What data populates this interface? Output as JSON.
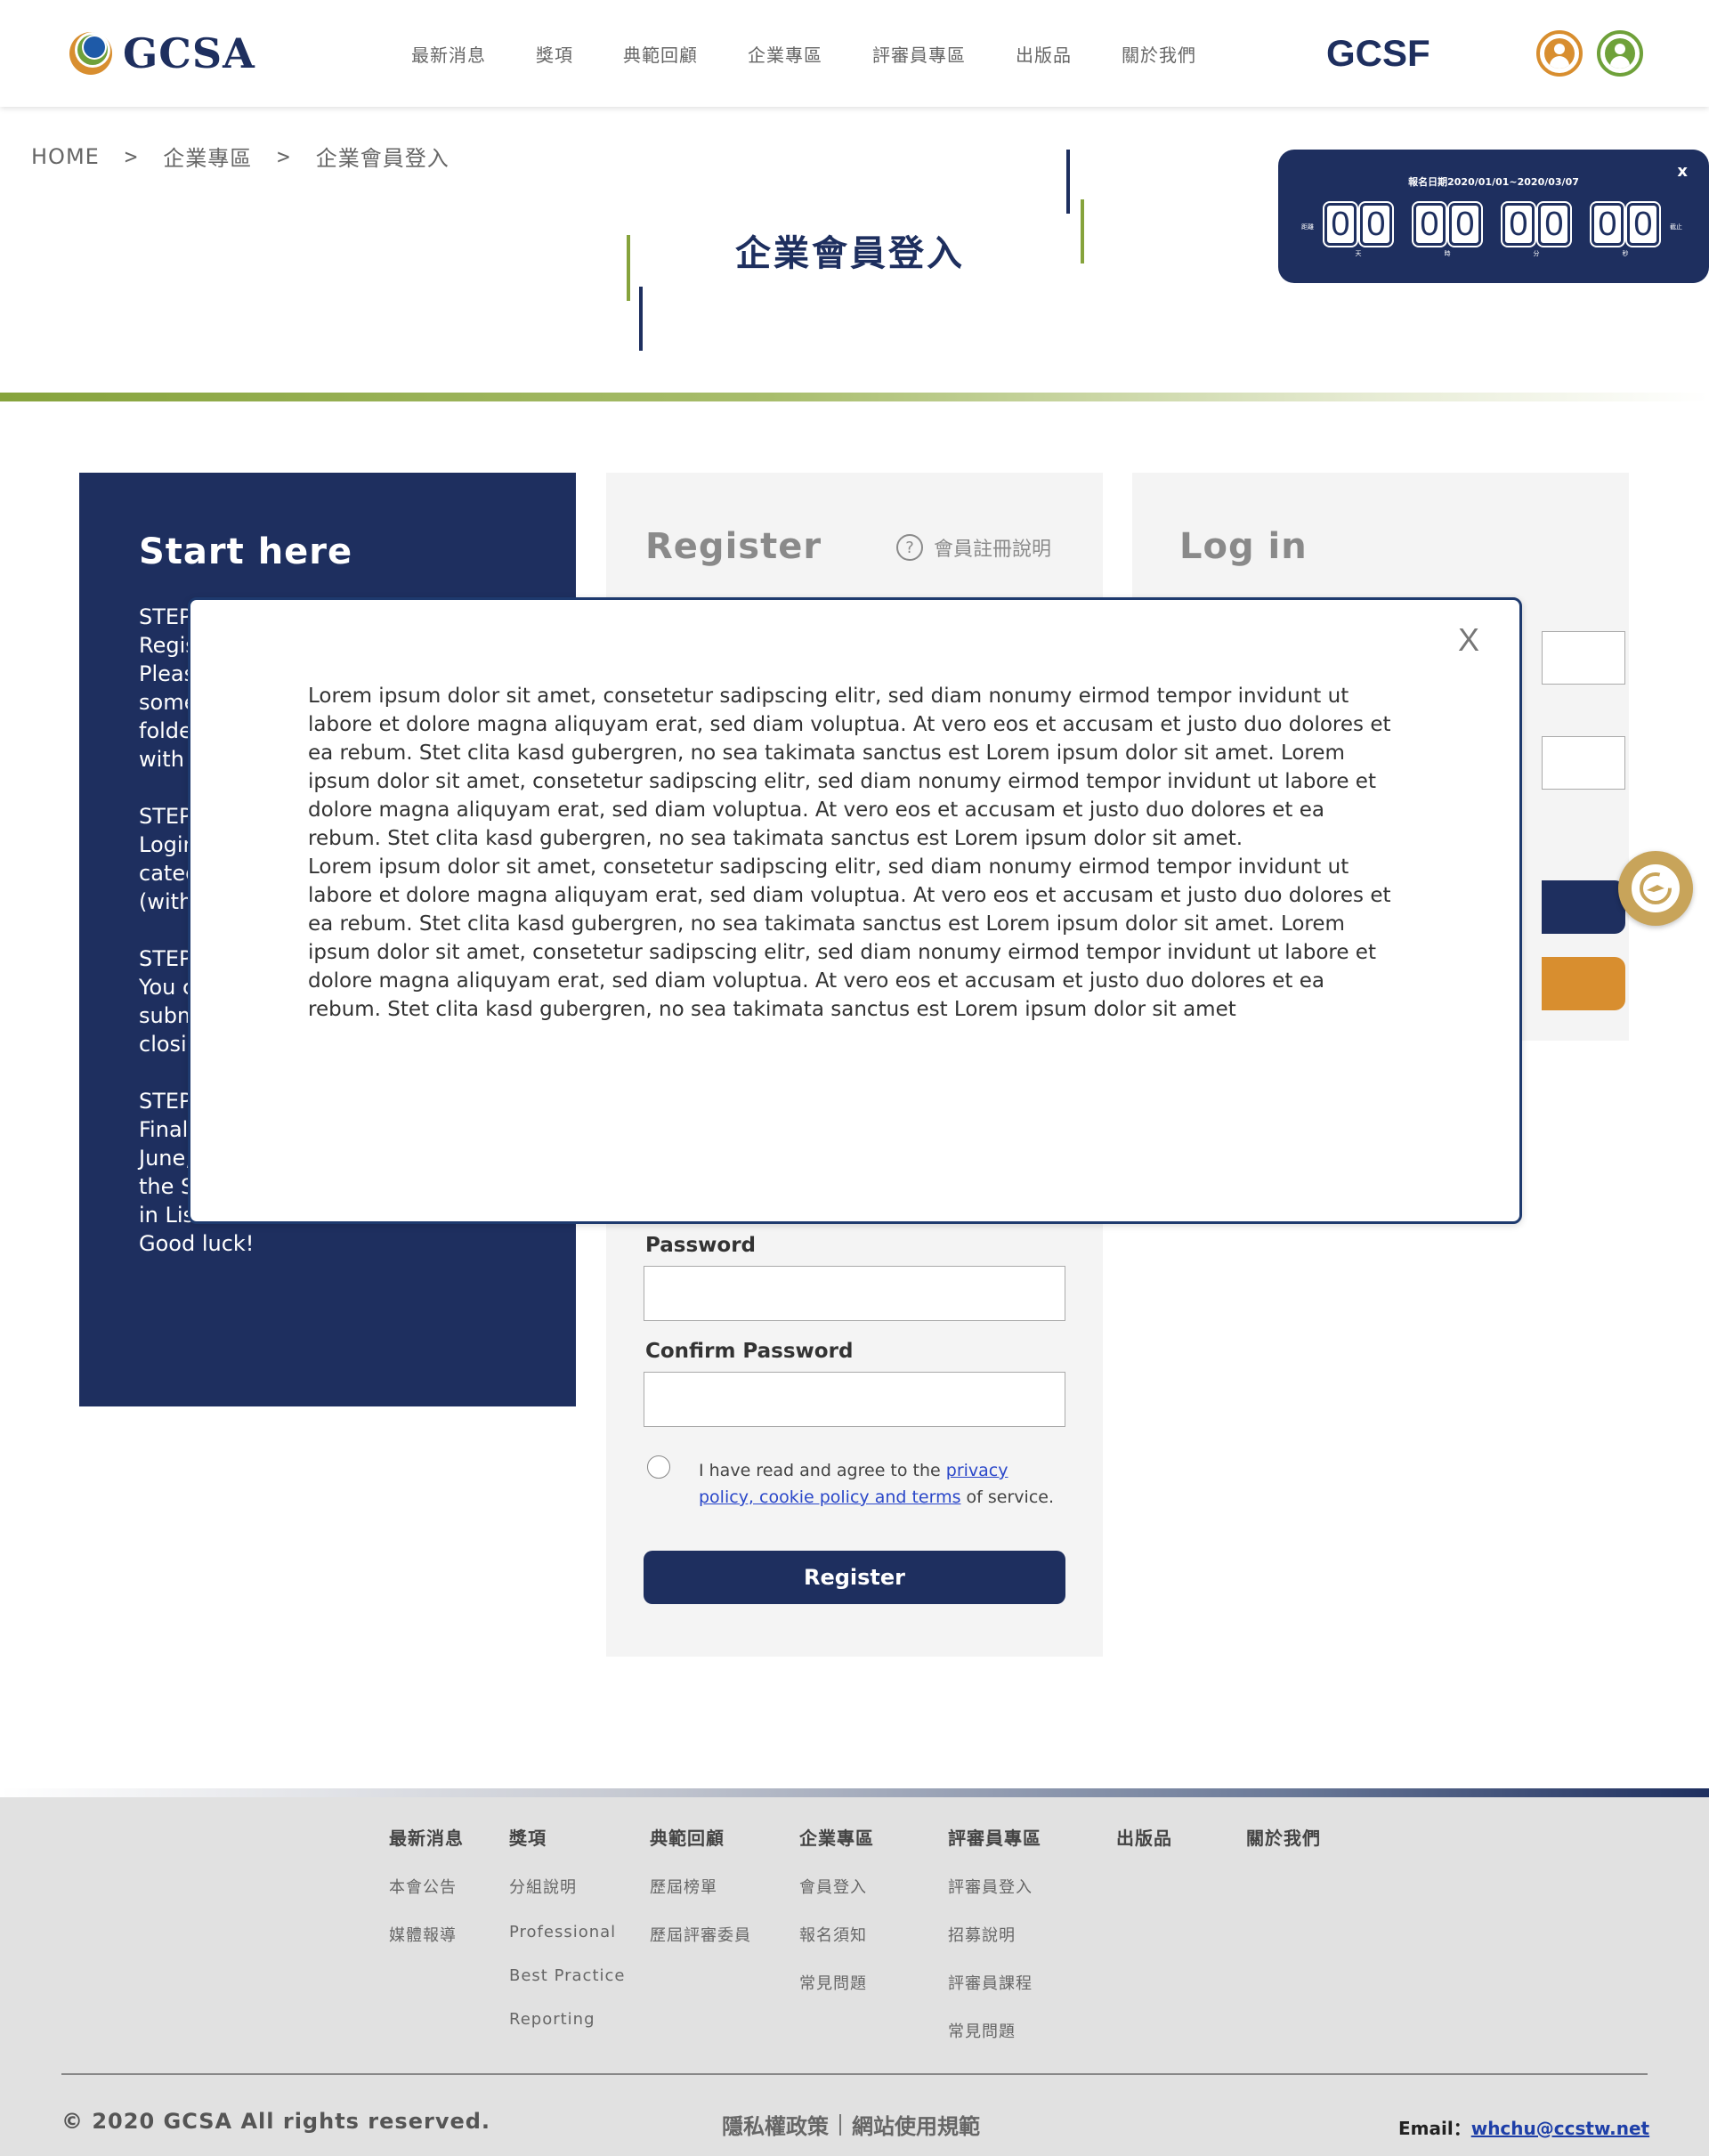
{
  "header": {
    "logo_text": "GCSA",
    "nav": [
      "最新消息",
      "獎項",
      "典範回顧",
      "企業專區",
      "評審員專區",
      "出版品",
      "關於我們"
    ],
    "brand_right": "GCSF"
  },
  "breadcrumb": [
    "HOME",
    "企業專區",
    "企業會員登入"
  ],
  "breadcrumb_sep": ">",
  "page_title": "企業會員登入",
  "countdown": {
    "close": "x",
    "date_text": "報名日期2020/01/01~2020/03/07",
    "left_label": "距離",
    "right_label": "截止",
    "units": [
      {
        "digits": [
          "0",
          "0"
        ],
        "label": "天"
      },
      {
        "digits": [
          "0",
          "0"
        ],
        "label": "時"
      },
      {
        "digits": [
          "0",
          "0"
        ],
        "label": "分"
      },
      {
        "digits": [
          "0",
          "0"
        ],
        "label": "秒"
      }
    ]
  },
  "start": {
    "title": "Start here",
    "text": "STEP\nRegis\nPleas\nsome\nfolde\nwith\n\nSTEP\nLogin\ncateg\n(with\n\nSTEP\nYou c\nsubm\nclosi\n\nSTEP\nFinal\nJune,\nthe S\nin Lis\nGood luck!"
  },
  "register": {
    "title": "Register",
    "help_label": "會員註冊說明",
    "help_icon": "?",
    "password_label": "Password",
    "confirm_label": "Confirm Password",
    "agree_prefix": "I have read and agree to the ",
    "agree_link": "privacy policy, cookie policy and terms",
    "agree_suffix": " of service.",
    "button": "Register"
  },
  "login": {
    "title": "Log in"
  },
  "modal": {
    "close": "X",
    "text": "Lorem ipsum dolor sit amet, consetetur sadipscing elitr, sed diam nonumy eirmod tempor invidunt ut labore et dolore magna aliquyam erat, sed diam voluptua. At vero eos et accusam et justo duo dolores et ea rebum. Stet clita kasd gubergren, no sea takimata sanctus est Lorem ipsum dolor sit amet. Lorem ipsum dolor sit amet, consetetur sadipscing elitr, sed diam nonumy eirmod tempor invidunt ut labore et dolore magna aliquyam erat, sed diam voluptua. At vero eos et accusam et justo duo dolores et ea rebum. Stet clita kasd gubergren, no sea takimata sanctus est Lorem ipsum dolor sit amet.",
    "text2": "Lorem ipsum dolor sit amet, consetetur sadipscing elitr, sed diam nonumy eirmod tempor invidunt ut labore et dolore magna aliquyam erat, sed diam voluptua. At vero eos et accusam et justo duo dolores et ea rebum. Stet clita kasd gubergren, no sea takimata sanctus est Lorem ipsum dolor sit amet. Lorem ipsum dolor sit amet, consetetur sadipscing elitr, sed diam nonumy eirmod tempor invidunt ut labore et dolore magna aliquyam erat, sed diam voluptua. At vero eos et accusam et justo duo dolores et ea rebum. Stet clita kasd gubergren, no sea takimata sanctus est Lorem ipsum dolor sit amet"
  },
  "footer": {
    "columns": [
      {
        "head": "最新消息",
        "items": [
          "本會公告",
          "媒體報導"
        ]
      },
      {
        "head": "獎項",
        "items": [
          "分組說明",
          "Professional",
          "Best Practice",
          "Reporting"
        ]
      },
      {
        "head": "典範回顧",
        "items": [
          "歷屆榜單",
          "歷屆評審委員"
        ]
      },
      {
        "head": "企業專區",
        "items": [
          "會員登入",
          "報名須知",
          "常見問題"
        ]
      },
      {
        "head": "評審員專區",
        "items": [
          "評審員登入",
          "招募說明",
          "評審員課程",
          "常見問題"
        ]
      },
      {
        "head": "出版品",
        "items": []
      },
      {
        "head": "關於我們",
        "items": []
      }
    ],
    "copyright": "© 2020 GCSA All rights reserved.",
    "privacy": "隱私權政策",
    "terms": "網站使用規範",
    "email_label": "Email：",
    "email": "whchu@ccstw.net"
  },
  "colors": {
    "navy": "#1e2f5f",
    "green": "#6fa13a",
    "orange": "#d88e2f"
  }
}
